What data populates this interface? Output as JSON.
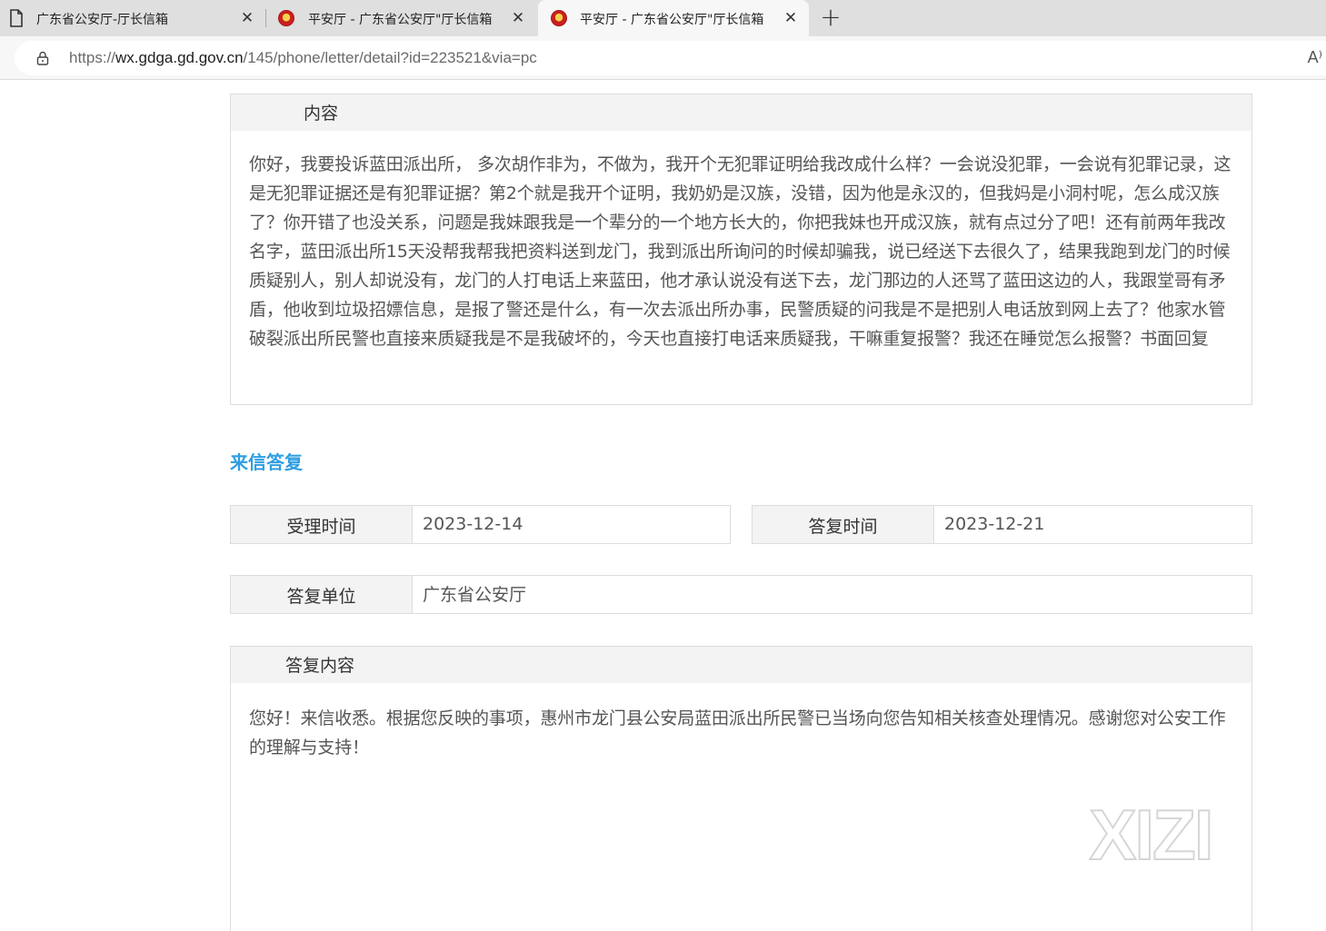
{
  "browser": {
    "tabs": [
      {
        "title": "广东省公安厅-厅长信箱",
        "icon": "document-icon",
        "active": false
      },
      {
        "title": "平安厅 - 广东省公安厅\"厅长信箱",
        "icon": "police-emblem-icon",
        "active": false
      },
      {
        "title": "平安厅 - 广东省公安厅\"厅长信箱",
        "icon": "police-emblem-icon",
        "active": true
      }
    ],
    "close_glyph": "✕",
    "new_tab_glyph": "+",
    "url_scheme": "https://",
    "url_host": "wx.gdga.gd.gov.cn",
    "url_path": "/145/phone/letter/detail?id=223521&via=pc",
    "read_aloud_label": "A⁾"
  },
  "letter": {
    "content_header": "内容",
    "content_text": "你好，我要投诉蓝田派出所， 多次胡作非为，不做为，我开个无犯罪证明给我改成什么样？一会说没犯罪，一会说有犯罪记录，这是无犯罪证据还是有犯罪证据？第2个就是我开个证明，我奶奶是汉族，没错，因为他是永汉的，但我妈是小洞村呢，怎么成汉族了？你开错了也没关系，问题是我妹跟我是一个辈分的一个地方长大的，你把我妹也开成汉族，就有点过分了吧！还有前两年我改名字，蓝田派出所15天没帮我帮我把资料送到龙门，我到派出所询问的时候却骗我，说已经送下去很久了，结果我跑到龙门的时候质疑别人，别人却说没有，龙门的人打电话上来蓝田，他才承认说没有送下去，龙门那边的人还骂了蓝田这边的人，我跟堂哥有矛盾，他收到垃圾招嫖信息，是报了警还是什么，有一次去派出所办事，民警质疑的问我是不是把别人电话放到网上去了？他家水管破裂派出所民警也直接来质疑我是不是我破坏的，今天也直接打电话来质疑我，干嘛重复报警？我还在睡觉怎么报警？书面回复"
  },
  "reply": {
    "section_title": "来信答复",
    "accept_time_label": "受理时间",
    "accept_time_value": "2023-12-14",
    "reply_time_label": "答复时间",
    "reply_time_value": "2023-12-21",
    "reply_unit_label": "答复单位",
    "reply_unit_value": "广东省公安厅",
    "reply_content_header": "答复内容",
    "reply_content_text": "您好！来信收悉。根据您反映的事项，惠州市龙门县公安局蓝田派出所民警已当场向您告知相关核查处理情况。感谢您对公安工作的理解与支持！"
  },
  "watermark_text": "XIZI"
}
